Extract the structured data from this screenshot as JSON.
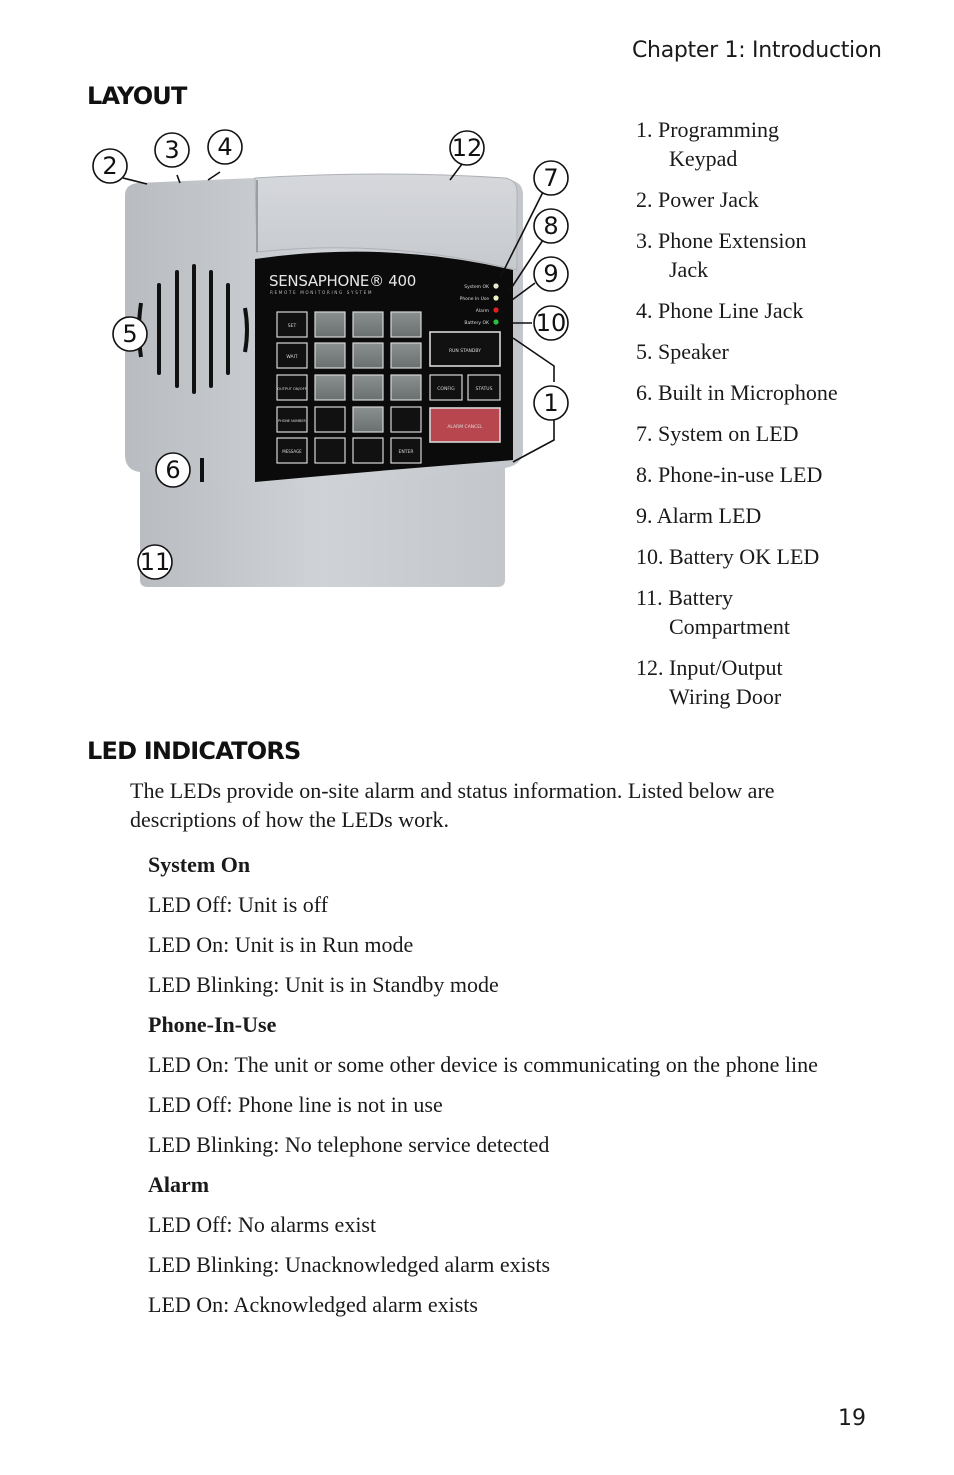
{
  "header": {
    "chapter": "Chapter 1: Introduction"
  },
  "layout_section": {
    "title": "LAYOUT",
    "device": {
      "brand": "SENSAPHONE® 400",
      "subtitle": "REMOTE MONITORING SYSTEM",
      "leds": [
        {
          "label": "System OK",
          "color": "#e8e8d0"
        },
        {
          "label": "Phone In Use",
          "color": "#f0f0c0"
        },
        {
          "label": "Alarm",
          "color": "#e02020"
        },
        {
          "label": "Battery OK",
          "color": "#2fbf3f"
        }
      ],
      "keys": {
        "set": "SET",
        "wait": "WAIT",
        "output": "OUTPUT ON/OFF",
        "phone_number": "PHONE NUMBER",
        "message": "MESSAGE",
        "run_standby": "RUN STANDBY",
        "config": "CONFIG",
        "status": "STATUS",
        "alarm_cancel": "ALARM CANCEL",
        "enter": "ENTER"
      }
    },
    "callouts": [
      "1",
      "2",
      "3",
      "4",
      "5",
      "6",
      "7",
      "8",
      "9",
      "10",
      "11",
      "12"
    ],
    "legend": [
      {
        "num": "1.",
        "line1": "Programming",
        "line2": "Keypad"
      },
      {
        "num": "2.",
        "line1": "Power Jack",
        "line2": ""
      },
      {
        "num": "3.",
        "line1": "Phone Extension",
        "line2": "Jack"
      },
      {
        "num": "4.",
        "line1": "Phone Line Jack",
        "line2": ""
      },
      {
        "num": "5.",
        "line1": "Speaker",
        "line2": ""
      },
      {
        "num": "6.",
        "line1": "Built in Microphone",
        "line2": ""
      },
      {
        "num": "7.",
        "line1": "System on LED",
        "line2": ""
      },
      {
        "num": "8.",
        "line1": "Phone-in-use LED",
        "line2": ""
      },
      {
        "num": "9.",
        "line1": "Alarm LED",
        "line2": ""
      },
      {
        "num": "10.",
        "line1": "Battery OK LED",
        "line2": ""
      },
      {
        "num": "11.",
        "line1": "Battery",
        "line2": "Compartment"
      },
      {
        "num": "12.",
        "line1": "Input/Output",
        "line2": "Wiring Door"
      }
    ]
  },
  "led_section": {
    "title": "LED INDICATORS",
    "intro": "The LEDs provide on-site alarm and status information. Listed below are descriptions of how the LEDs work.",
    "groups": [
      {
        "title": "System On",
        "lines": [
          "LED Off: Unit is off",
          "LED On: Unit is in Run mode",
          "LED Blinking: Unit is in Standby mode"
        ]
      },
      {
        "title": "Phone-In-Use",
        "lines": [
          "LED On: The unit or some other device is communicating on the phone line",
          "LED Off: Phone line is not in use",
          "LED Blinking: No telephone service detected"
        ]
      },
      {
        "title": "Alarm",
        "lines": [
          "LED Off: No alarms exist",
          "LED Blinking: Unacknowledged alarm exists",
          "LED On: Acknowledged alarm exists"
        ]
      }
    ]
  },
  "footer": {
    "page_number": "19"
  }
}
